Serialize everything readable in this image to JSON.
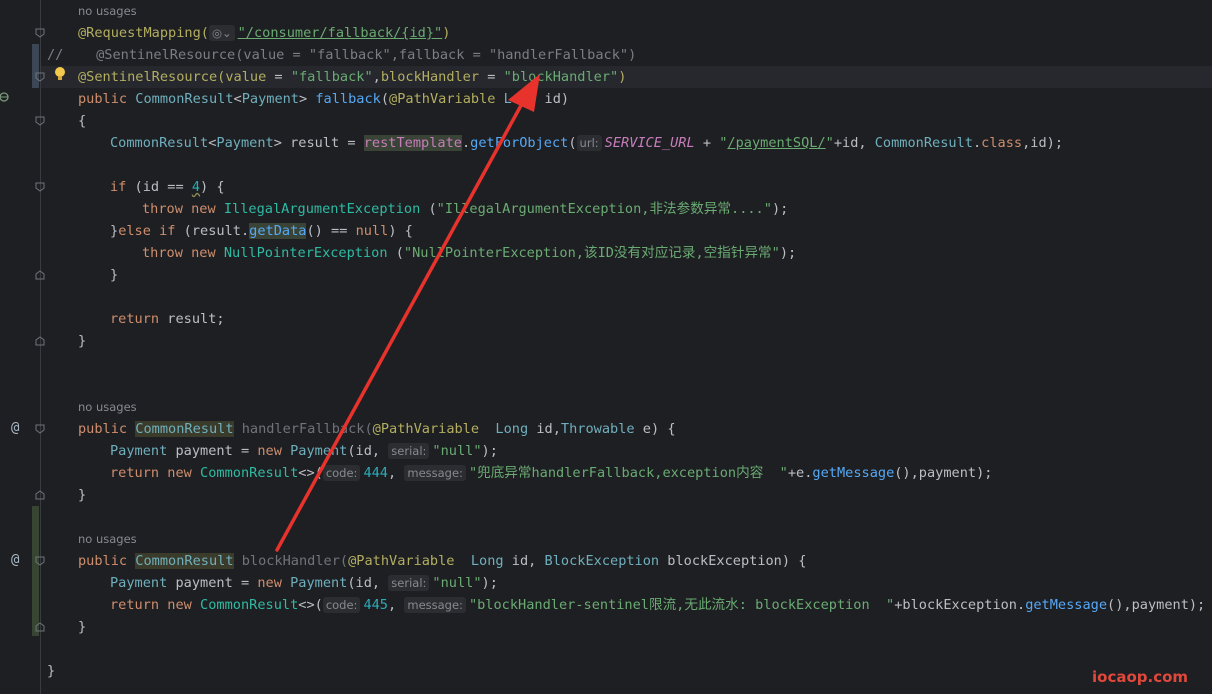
{
  "hints": {
    "no_usages_1": "no usages",
    "no_usages_2": "no usages",
    "no_usages_3": "no usages"
  },
  "lines": {
    "l1_ann": "@RequestMapping(",
    "l1_path": "\"/consumer/fallback/{id}\"",
    "l1_close": ")",
    "l2_comment": "//    @SentinelResource(value = \"fallback\",fallback = \"handlerFallback\")",
    "l3_ann": "@SentinelResource(",
    "l3_value_key": "value",
    "l3_eq1": " = ",
    "l3_value": "\"fallback\"",
    "l3_comma": ",",
    "l3_bh_key": "blockHandler",
    "l3_eq2": " = ",
    "l3_bh": "\"blockHandler\"",
    "l3_close": ")",
    "l4_public": "public ",
    "l4_type": "CommonResult",
    "l4_lt": "<",
    "l4_payment": "Payment",
    "l4_gt": "> ",
    "l4_fn": "fallback",
    "l4_open": "(",
    "l4_pv": "@PathVariable ",
    "l4_long": "Long",
    "l4_id": " id)",
    "l5_brace": "{",
    "l6_type": "CommonResult",
    "l6_lt": "<",
    "l6_payment": "Payment",
    "l6_gt": "> result = ",
    "l6_rt": "restTemplate",
    "l6_dot": ".",
    "l6_get": "getForObject",
    "l6_paren": "(",
    "l6_url_hint": "url:",
    "l6_service": "SERVICE_URL",
    "l6_plus": " + ",
    "l6_q1": "\"",
    "l6_path": "/paymentSQL/",
    "l6_q2": "\"",
    "l6_rest1": "+id, ",
    "l6_cr": "CommonResult",
    "l6_dot2": ".",
    "l6_class": "class",
    "l6_rest2": ",id);",
    "l7_if": "if",
    "l7_cond1": " (id == ",
    "l7_num": "4",
    "l7_cond2": ") {",
    "l8_throw": "throw ",
    "l8_new": "new ",
    "l8_ex": "IllegalArgumentException",
    "l8_sp": " (",
    "l8_msg": "\"IllegalArgumentException,非法参数异常....\"",
    "l8_end": ");",
    "l9_close": "}",
    "l9_else": "else if",
    "l9_rest1": " (result.",
    "l9_getdata": "getData",
    "l9_rest2": "() == ",
    "l9_null": "null",
    "l9_rest3": ") {",
    "l10_throw": "throw ",
    "l10_new": "new ",
    "l10_ex": "NullPointerException",
    "l10_sp": " (",
    "l10_msg": "\"NullPointerException,该ID没有对应记录,空指针异常\"",
    "l10_end": ");",
    "l11_brace": "}",
    "l12_return": "return",
    "l12_rest": " result;",
    "l13_brace": "}",
    "l14_public": "public ",
    "l14_type": "CommonResult",
    "l14_fn": " handlerFallback(",
    "l14_pv": "@PathVariable",
    "l14_long": "  Long",
    "l14_id": " id,",
    "l14_throw": "Throwable",
    "l14_e": " e) {",
    "l15_payment": "Payment",
    "l15_mid": " payment = ",
    "l15_new": "new ",
    "l15_payment2": "Payment",
    "l15_open": "(id, ",
    "l15_hint": "serial:",
    "l15_null": "\"null\"",
    "l15_end": ");",
    "l16_return": "return ",
    "l16_new": "new ",
    "l16_cr": "CommonResult",
    "l16_diamond": "<>(",
    "l16_code_hint": "code:",
    "l16_code": "444",
    "l16_comma": ", ",
    "l16_msg_hint": "message:",
    "l16_msg": "\"兜底异常handlerFallback,exception内容  \"",
    "l16_plus": "+e.",
    "l16_getmsg": "getMessage",
    "l16_end": "(),payment);",
    "l17_brace": "}",
    "l18_public": "public ",
    "l18_type": "CommonResult",
    "l18_fn": " blockHandler(",
    "l18_pv": "@PathVariable",
    "l18_long": "  Long",
    "l18_id": " id, ",
    "l18_bex": "BlockException",
    "l18_rest": " blockException) {",
    "l19_payment": "Payment",
    "l19_mid": " payment = ",
    "l19_new": "new ",
    "l19_payment2": "Payment",
    "l19_open": "(id, ",
    "l19_hint": "serial:",
    "l19_null": "\"null\"",
    "l19_end": ");",
    "l20_return": "return ",
    "l20_new": "new ",
    "l20_cr": "CommonResult",
    "l20_diamond": "<>(",
    "l20_code_hint": "code:",
    "l20_code": "445",
    "l20_comma": ", ",
    "l20_msg_hint": "message:",
    "l20_msg": "\"blockHandler-sentinel限流,无此流水: blockException  \"",
    "l20_plus": "+blockException.",
    "l20_getmsg": "getMessage",
    "l20_end": "(),payment);",
    "l21_brace": "}",
    "l22_brace": "}"
  },
  "watermark": "iocaop.com",
  "colors": {
    "background": "#1e1f22",
    "keyword": "#cf8e6d",
    "annotation": "#b3ae60",
    "string": "#6aab73",
    "arrow": "#e8322c"
  }
}
